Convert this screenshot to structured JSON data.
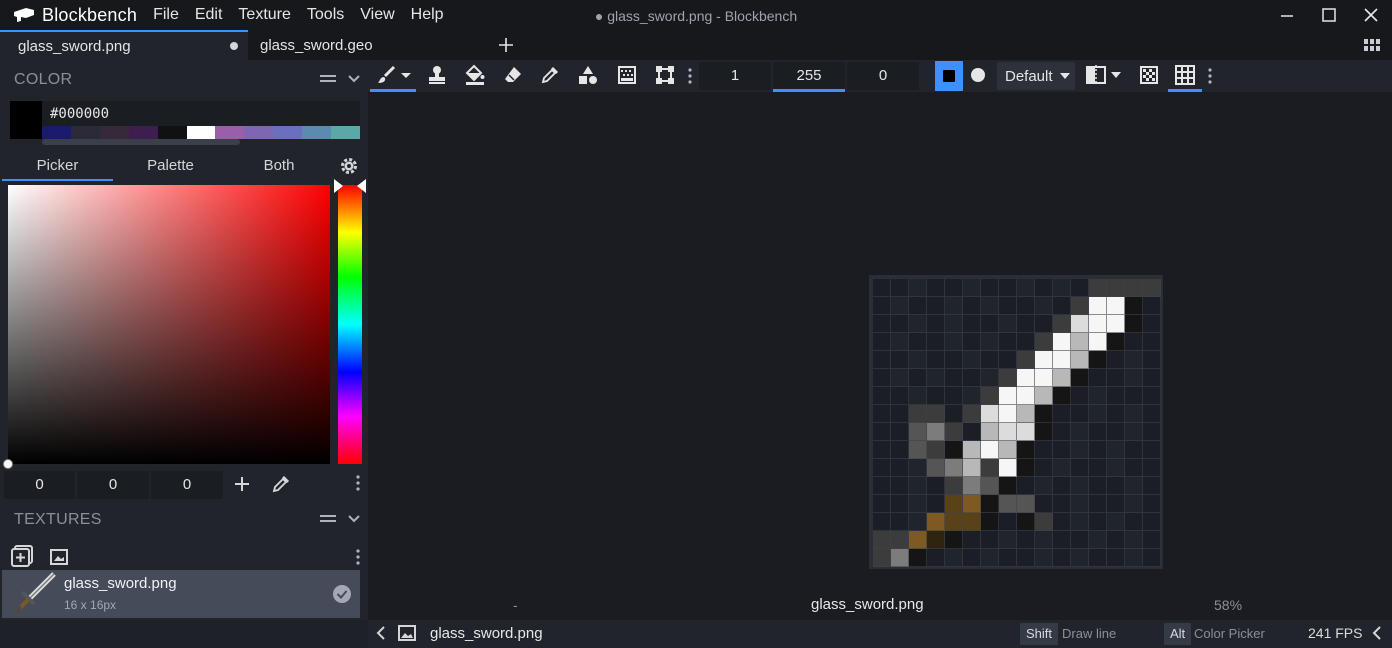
{
  "app": {
    "name": "Blockbench",
    "window_title": "● glass_sword.png - Blockbench",
    "menu": [
      "File",
      "Edit",
      "Texture",
      "Tools",
      "View",
      "Help"
    ]
  },
  "tabs": [
    {
      "label": "glass_sword.png",
      "active": true,
      "unsaved": true
    },
    {
      "label": "glass_sword.geo",
      "active": false
    }
  ],
  "color_panel": {
    "title": "COLOR",
    "hex": "#000000",
    "history": [
      "#1a1a6e",
      "#2a2a38",
      "#352a3a",
      "#3e1e4e",
      "#111114",
      "#ffffff",
      "#9b5ea8",
      "#7e66b4",
      "#6a70bd",
      "#5c8bb0",
      "#5aa9a6"
    ],
    "tabs": [
      "Picker",
      "Palette",
      "Both"
    ],
    "rgb": {
      "r": "0",
      "g": "0",
      "b": "0"
    }
  },
  "textures_panel": {
    "title": "TEXTURES",
    "items": [
      {
        "name": "glass_sword.png",
        "size": "16 x 16px"
      }
    ]
  },
  "toolbar": {
    "brush_size": "1",
    "opacity": "255",
    "softness": "0",
    "blend_mode": "Default"
  },
  "viewport": {
    "left_label": "-",
    "texture_name": "glass_sword.png",
    "zoom": "58%"
  },
  "statusbar": {
    "file": "glass_sword.png",
    "hints": [
      {
        "key": "Shift",
        "desc": "Draw line"
      },
      {
        "key": "Alt",
        "desc": "Color Picker"
      }
    ],
    "fps": "241 FPS"
  },
  "colors": {
    "accent": "#3e90ff",
    "panel_bg": "#21252b",
    "viewport_bg": "#1a1c21",
    "selected_item": "#454b58"
  }
}
